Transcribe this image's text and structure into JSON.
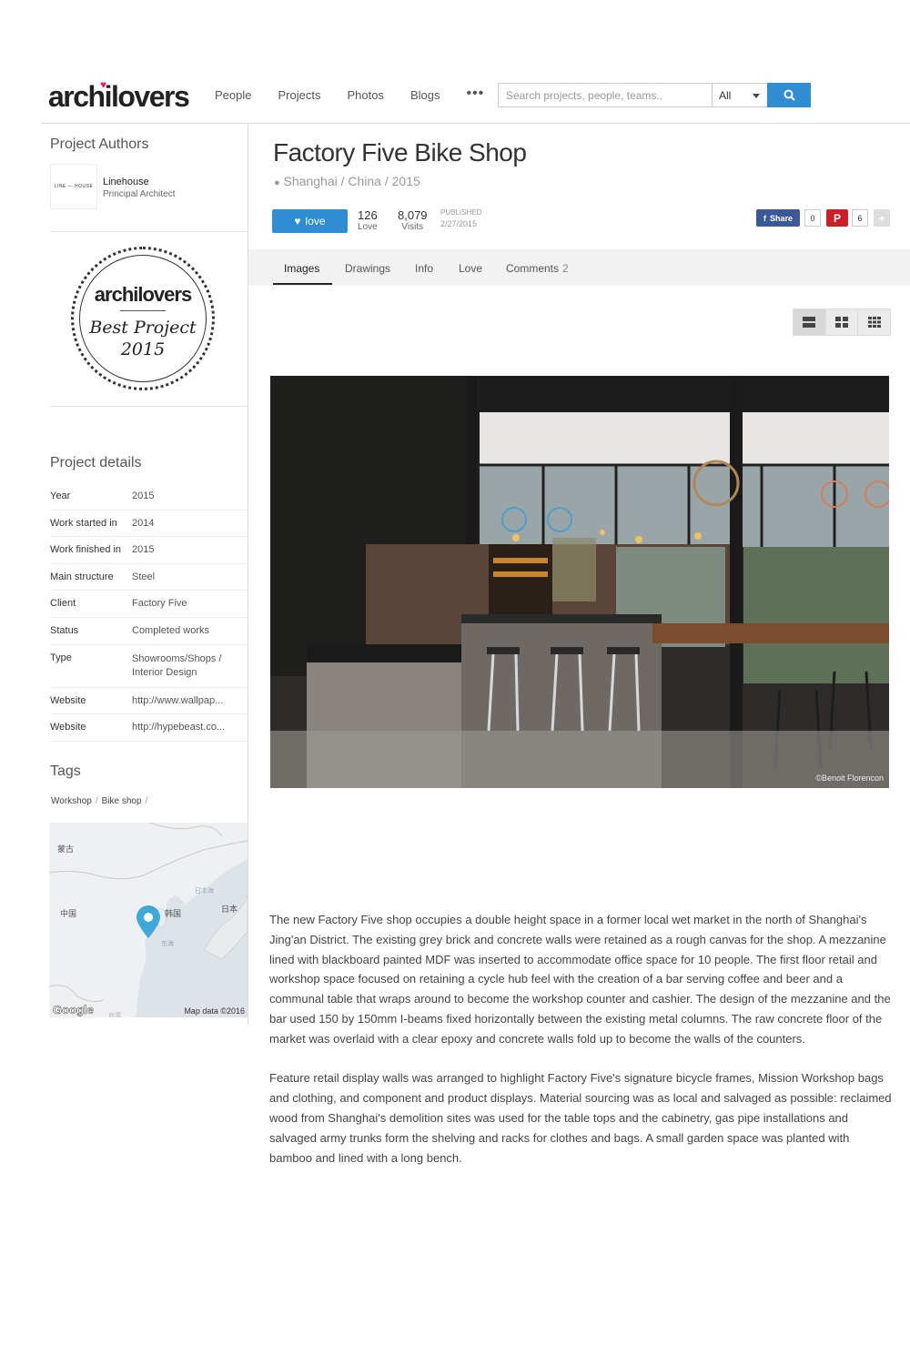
{
  "header": {
    "logo": "archilovers",
    "nav": [
      "People",
      "Projects",
      "Photos",
      "Blogs"
    ],
    "more": "•••",
    "search_placeholder": "Search projects, people, teams..",
    "search_scope": "All"
  },
  "sidebar": {
    "authors_heading": "Project Authors",
    "author": {
      "logo_text": "LINE — HOUSE",
      "name": "Linehouse",
      "role": "Principal Architect"
    },
    "badge": {
      "logo": "archilovers",
      "title": "Best Project",
      "year": "2015"
    },
    "details_heading": "Project details",
    "details": [
      {
        "label": "Year",
        "value": "2015"
      },
      {
        "label": "Work started in",
        "value": "2014"
      },
      {
        "label": "Work finished in",
        "value": "2015"
      },
      {
        "label": "Main structure",
        "value": "Steel"
      },
      {
        "label": "Client",
        "value": "Factory Five"
      },
      {
        "label": "Status",
        "value": "Completed works"
      },
      {
        "label": "Type",
        "value": "Showrooms/Shops / Interior Design"
      },
      {
        "label": "Website",
        "value": "http://www.wallpap..."
      },
      {
        "label": "Website",
        "value": "http://hypebeast.co..."
      }
    ],
    "tags_heading": "Tags",
    "tags": [
      "Workshop",
      "Bike shop"
    ],
    "map": {
      "labels": [
        "蒙古",
        "中国",
        "韩国",
        "日本",
        "日本海",
        "东海",
        "台湾"
      ],
      "attribution": "Map data ©2016",
      "provider": "Google"
    }
  },
  "project": {
    "title": "Factory Five Bike Shop",
    "location": "Shanghai / China / 2015",
    "love_button": "love",
    "love_count": "126",
    "love_label": "Love",
    "visits_count": "8,079",
    "visits_label": "Visits",
    "published_label": "PUBLISHED",
    "published_date": "2/27/2015",
    "fb_share": "Share",
    "fb_count": "0",
    "pin_count": "6",
    "tabs": [
      "Images",
      "Drawings",
      "Info",
      "Love",
      "Comments"
    ],
    "comments_count": "2",
    "photo_credit": "©Benoit Florencon",
    "description": [
      "The new Factory Five shop occupies a double height space in a former local wet market in the north of Shanghai's Jing'an District. The existing grey brick and concrete walls were retained as a rough canvas for the shop. A mezzanine lined with blackboard painted MDF was inserted to accommodate office space for 10 people. The first floor retail and workshop space focused on retaining a cycle hub feel with the creation of a bar serving coffee and beer and a communal table that wraps around to become the workshop counter and cashier. The design of the mezzanine and the bar used 150 by 150mm I-beams fixed horizontally between the existing metal columns. The raw concrete floor of the market was overlaid with a clear epoxy and concrete walls fold up to become the walls of the counters.",
      "Feature retail display walls was arranged to highlight Factory Five's signature bicycle frames, Mission Workshop bags and clothing, and component and product displays. Material sourcing was as local and salvaged as possible: reclaimed wood from Shanghai's demolition sites was used for the table tops and the cabinetry, gas pipe installations and salvaged army trunks form the shelving and racks for clothes and bags. A small garden space was planted with bamboo and lined with a long bench."
    ]
  },
  "colors": {
    "accent": "#2f8dd1",
    "facebook": "#3b5998",
    "pinterest": "#cb2027",
    "heart": "#e0245e"
  }
}
